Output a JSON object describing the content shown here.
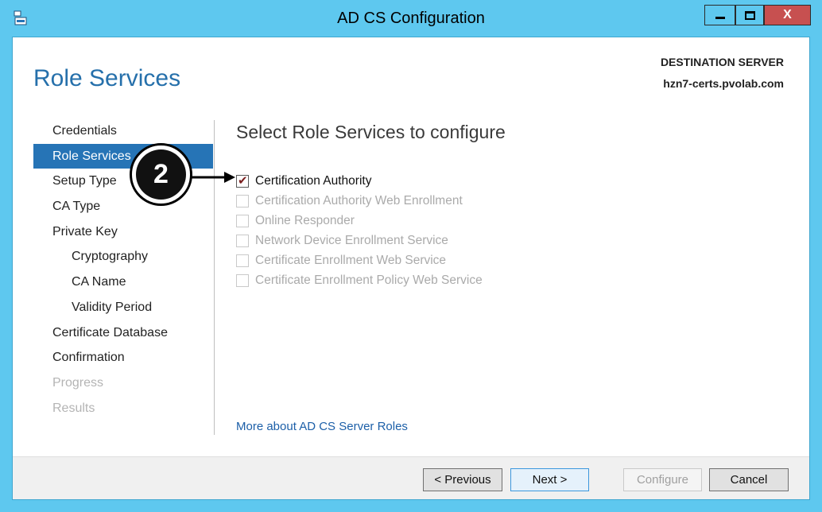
{
  "window": {
    "title": "AD CS Configuration",
    "app_icon": "server-manager-icon",
    "close_label": "X"
  },
  "header": {
    "page_title": "Role Services",
    "destination_label": "DESTINATION SERVER",
    "destination_server": "hzn7-certs.pvolab.com"
  },
  "nav": {
    "items": [
      {
        "label": "Credentials",
        "state": "normal"
      },
      {
        "label": "Role Services",
        "state": "selected"
      },
      {
        "label": "Setup Type",
        "state": "normal"
      },
      {
        "label": "CA Type",
        "state": "normal"
      },
      {
        "label": "Private Key",
        "state": "normal"
      },
      {
        "label": "Cryptography",
        "state": "sub"
      },
      {
        "label": "CA Name",
        "state": "sub"
      },
      {
        "label": "Validity Period",
        "state": "sub"
      },
      {
        "label": "Certificate Database",
        "state": "normal"
      },
      {
        "label": "Confirmation",
        "state": "normal"
      },
      {
        "label": "Progress",
        "state": "disabled"
      },
      {
        "label": "Results",
        "state": "disabled"
      }
    ]
  },
  "main": {
    "heading": "Select Role Services to configure",
    "roles": [
      {
        "label": "Certification Authority",
        "checked": true,
        "enabled": true
      },
      {
        "label": "Certification Authority Web Enrollment",
        "checked": false,
        "enabled": false
      },
      {
        "label": "Online Responder",
        "checked": false,
        "enabled": false
      },
      {
        "label": "Network Device Enrollment Service",
        "checked": false,
        "enabled": false
      },
      {
        "label": "Certificate Enrollment Web Service",
        "checked": false,
        "enabled": false
      },
      {
        "label": "Certificate Enrollment Policy Web Service",
        "checked": false,
        "enabled": false
      }
    ],
    "more_link": "More about AD CS Server Roles"
  },
  "footer": {
    "previous": "< Previous",
    "next": "Next >",
    "configure": "Configure",
    "cancel": "Cancel"
  },
  "annotation": {
    "step_number": "2"
  }
}
